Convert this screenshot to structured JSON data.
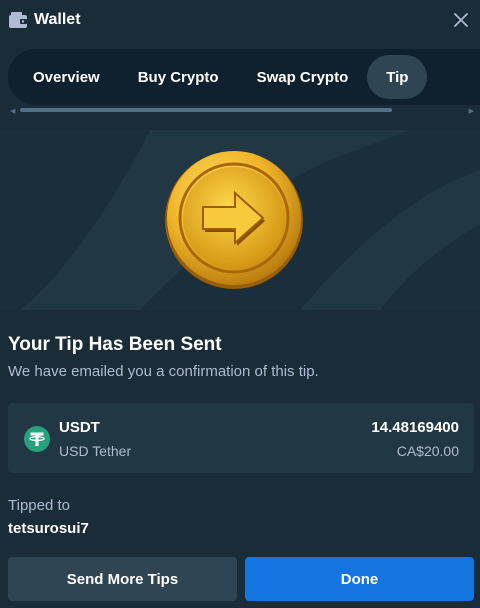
{
  "header": {
    "title": "Wallet",
    "icon": "wallet-icon",
    "close_icon": "close-icon"
  },
  "tabs": [
    {
      "label": "Overview",
      "active": false
    },
    {
      "label": "Buy Crypto",
      "active": false
    },
    {
      "label": "Swap Crypto",
      "active": false
    },
    {
      "label": "Tip",
      "active": true
    }
  ],
  "hero": {
    "icon": "gold-coin-arrow-icon"
  },
  "confirmation": {
    "title": "Your Tip Has Been Sent",
    "subtitle": "We have emailed you a confirmation of this tip."
  },
  "token": {
    "icon": "tether-icon",
    "symbol": "USDT",
    "name": "USD Tether",
    "amount": "14.48169400",
    "fiat_value": "CA$20.00"
  },
  "recipient": {
    "label": "Tipped to",
    "username": "tetsurosui7"
  },
  "actions": {
    "send_more_label": "Send More Tips",
    "done_label": "Done"
  },
  "colors": {
    "background": "#1a2c38",
    "panel": "#213743",
    "tab_bar": "#0f212e",
    "active_tab": "#2f4553",
    "primary_button": "#1475e1",
    "muted_text": "#b1bad3",
    "tether_green": "#26a17b"
  }
}
